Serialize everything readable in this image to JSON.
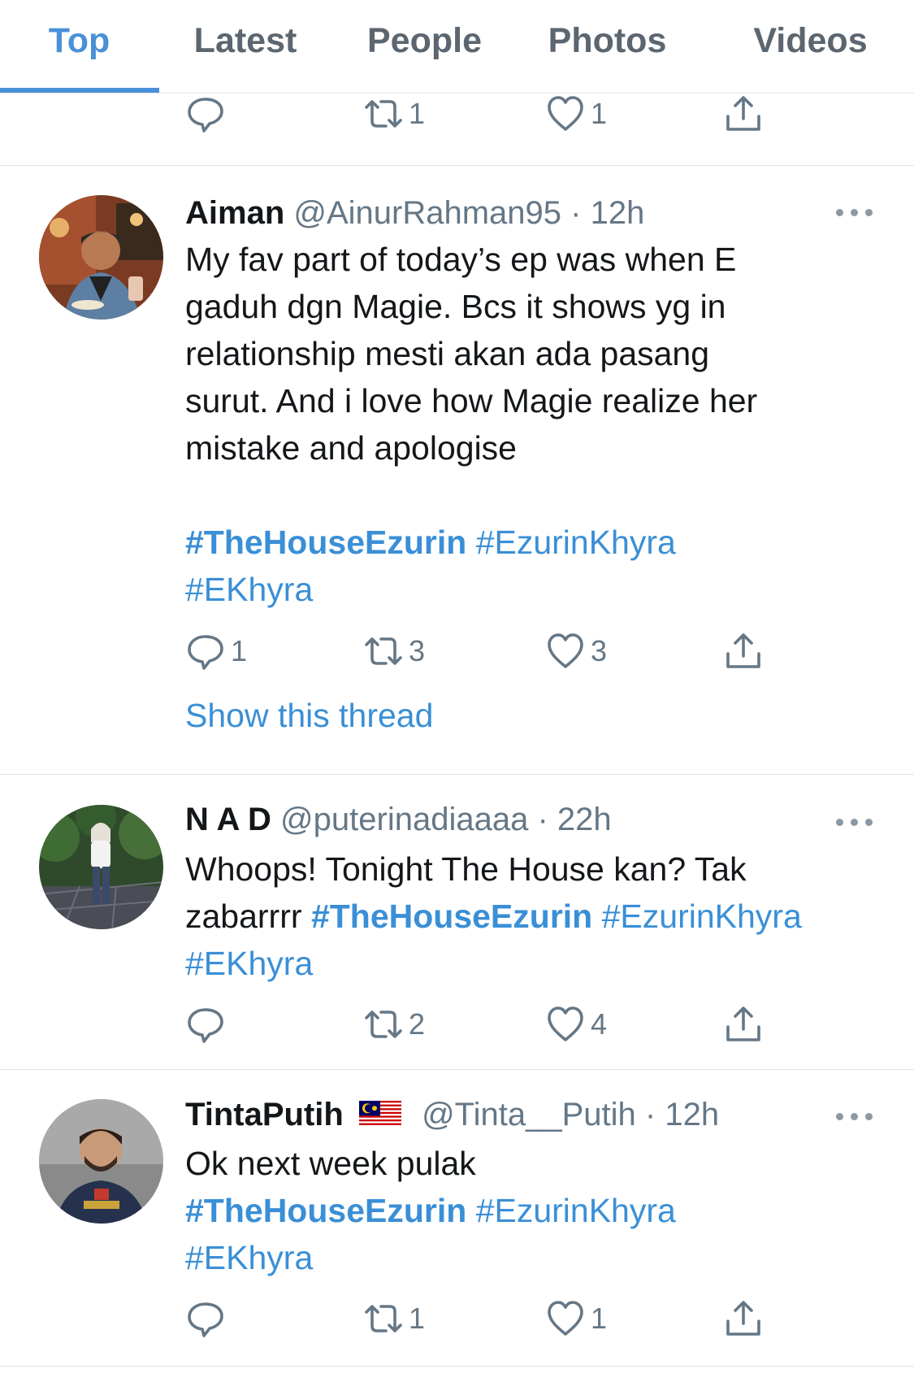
{
  "tabs": [
    {
      "label": "Top",
      "active": true
    },
    {
      "label": "Latest"
    },
    {
      "label": "People"
    },
    {
      "label": "Photos"
    },
    {
      "label": "Videos"
    }
  ],
  "accent_color": "#4a90d9",
  "prev_tweet_actions": {
    "replies": "",
    "retweets": "1",
    "likes": "1"
  },
  "tweets": [
    {
      "name": "Aiman",
      "handle": "@AinurRahman95",
      "time": "· 12h",
      "text_lines": [
        "My fav part of today’s ep was when E",
        "gaduh dgn Magie. Bcs it shows yg in",
        "relationship mesti akan ada pasang",
        "surut. And i love how Magie realize her",
        "mistake and apologise"
      ],
      "hashtags": [
        "#TheHouseEzurin",
        "#EzurinKhyra",
        "#EKhyra"
      ],
      "replies": "1",
      "retweets": "3",
      "likes": "3",
      "show_thread": "Show this thread"
    },
    {
      "name": "N A D",
      "handle": "@puterinadiaaaa",
      "time": "· 22h",
      "text_line1": "Whoops! Tonight The House kan? Tak",
      "text_line2_prefix": "zabarrrr",
      "hashtags": [
        "#TheHouseEzurin",
        "#EzurinKhyra",
        "#EKhyra"
      ],
      "replies": "",
      "retweets": "2",
      "likes": "4"
    },
    {
      "name": "TintaPutih",
      "flag_icon": "malaysia-flag-icon",
      "handle": "@Tinta__Putih",
      "time": "· 12h",
      "text_line1": "Ok next week pulak",
      "hashtags": [
        "#TheHouseEzurin",
        "#EzurinKhyra",
        "#EKhyra"
      ],
      "replies": "",
      "retweets": "1",
      "likes": "1"
    }
  ]
}
